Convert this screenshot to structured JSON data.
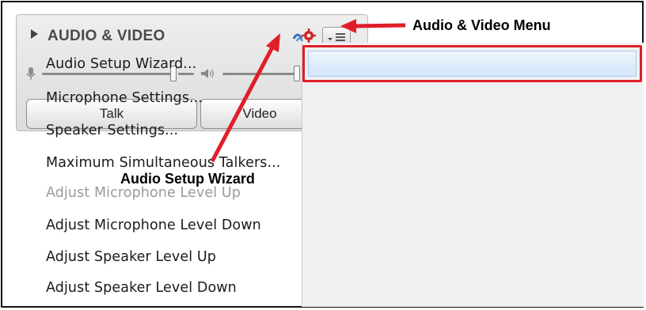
{
  "panel": {
    "title": "AUDIO & VIDEO",
    "talk_label": "Talk",
    "video_label": "Video",
    "icons": [
      "expand-triangle-icon",
      "audio-setup-wizard-icon",
      "menu-dropdown-icon",
      "microphone-icon",
      "speaker-icon"
    ]
  },
  "menu": {
    "items": [
      {
        "label": "Audio Setup Wizard...",
        "state": "highlighted"
      },
      {
        "label": "Microphone Settings...",
        "state": "enabled"
      },
      {
        "label": "Speaker Settings...",
        "state": "enabled"
      },
      {
        "label": "Maximum Simultaneous Talkers...",
        "state": "enabled"
      },
      {
        "label": "Adjust Microphone Level Up",
        "state": "disabled"
      },
      {
        "label": "Adjust Microphone Level Down",
        "state": "enabled"
      },
      {
        "label": "Adjust Speaker Level Up",
        "state": "enabled"
      },
      {
        "label": "Adjust Speaker Level Down",
        "state": "enabled"
      }
    ]
  },
  "annotations": {
    "menu_label": "Audio & Video Menu",
    "wizard_label": "Audio Setup Wizard"
  },
  "colors": {
    "annotation_red": "#e01e2a",
    "highlight_blue": "#d3e6fb",
    "disabled_text": "#9a9a9a"
  }
}
